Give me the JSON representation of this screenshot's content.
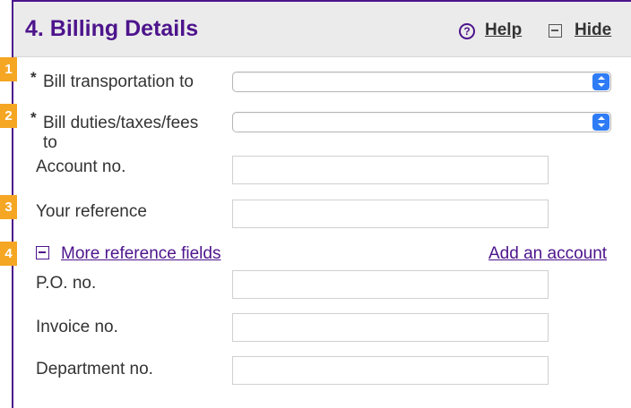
{
  "section": {
    "title": "4. Billing Details",
    "help_icon": "?",
    "help_label": "Help",
    "hide_label": "Hide"
  },
  "badges": [
    "1",
    "2",
    "3",
    "4"
  ],
  "required_marker": "*",
  "fields": {
    "bill_transportation_label": "Bill transportation to",
    "bill_transportation_value": "",
    "bill_duties_label_line1": "Bill duties/taxes/fees",
    "bill_duties_label_line2": "to",
    "bill_duties_value": "",
    "account_no_label": "Account no.",
    "your_reference_label": "Your reference",
    "po_no_label": "P.O. no.",
    "invoice_no_label": "Invoice no.",
    "department_no_label": "Department no."
  },
  "links": {
    "more_reference_fields": "More reference fields",
    "add_account": "Add an account"
  },
  "colors": {
    "brand_purple": "#4d148c",
    "badge_orange": "#f5a623",
    "select_arrow_blue": "#2f7cf6",
    "header_bg": "#ebebeb"
  },
  "icons": {
    "help": "help-circle-icon",
    "hide": "collapse-square-icon",
    "more_fields": "collapse-square-icon",
    "select": "chevron-up-down-icon"
  }
}
